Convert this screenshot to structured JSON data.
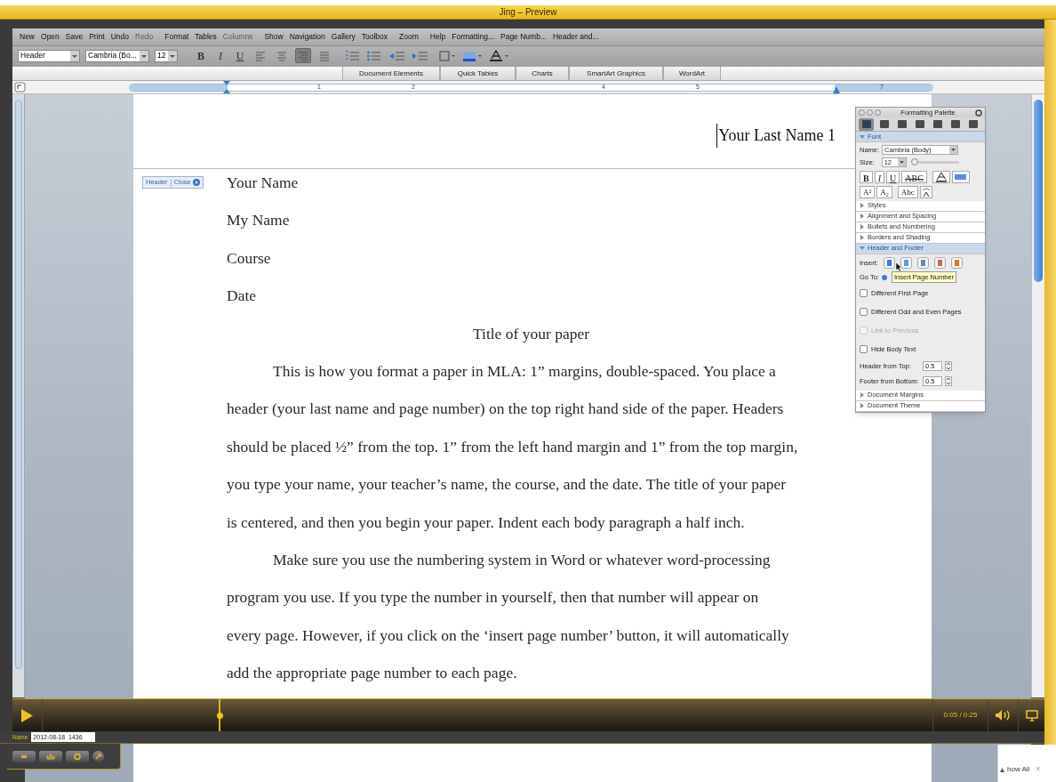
{
  "window": {
    "title": "Jing – Preview"
  },
  "toolbar": [
    {
      "label": "New",
      "disabled": false
    },
    {
      "label": "Open",
      "disabled": false
    },
    {
      "label": "Save",
      "disabled": false
    },
    {
      "label": "Print",
      "disabled": false
    },
    {
      "label": "Undo",
      "disabled": false
    },
    {
      "label": "Redo",
      "disabled": true
    },
    {
      "label": "Format",
      "disabled": false
    },
    {
      "label": "Tables",
      "disabled": false
    },
    {
      "label": "Columns",
      "disabled": true
    },
    {
      "label": "Show",
      "disabled": false
    },
    {
      "label": "Navigation",
      "disabled": false
    },
    {
      "label": "Gallery",
      "disabled": false
    },
    {
      "label": "Toolbox",
      "disabled": false
    },
    {
      "label": "Zoom",
      "disabled": false
    },
    {
      "label": "Help",
      "disabled": false
    },
    {
      "label": "Formatting...",
      "disabled": false
    },
    {
      "label": "Page Numb...",
      "disabled": false
    },
    {
      "label": "Header and...",
      "disabled": false
    }
  ],
  "format_bar": {
    "style": "Header",
    "font": "Cambria (Bo...",
    "size": "12",
    "bold": "B",
    "italic": "I",
    "underline": "U",
    "align_buttons": [
      {
        "selected": false
      },
      {
        "selected": false
      },
      {
        "selected": true
      },
      {
        "selected": false
      }
    ]
  },
  "gallery_tabs": [
    "Document Elements",
    "Quick Tables",
    "Charts",
    "SmartArt Graphics",
    "WordArt"
  ],
  "ruler": {
    "labels": [
      "1",
      "2",
      "4",
      "5",
      "7"
    ]
  },
  "document": {
    "header_text": "Your Last Name 1",
    "header_tab": {
      "label": "Header",
      "close": "Close"
    },
    "heading_lines": [
      "Your Name",
      "My Name",
      "Course",
      "Date"
    ],
    "title": "Title of your paper",
    "paragraphs": [
      {
        "lines": [
          "This is how you format a paper in MLA: 1” margins, double-spaced. You place a",
          "header (your last name and page number) on the top right hand side of the paper. Headers",
          "should be placed ½” from the top. 1” from the left hand margin and 1” from the top margin,",
          "you type your name, your teacher’s name, the course, and the date. The title of your paper",
          "is centered, and then you begin your paper. Indent each body paragraph a half inch."
        ]
      },
      {
        "lines": [
          "Make sure you use the numbering system in Word or whatever word-processing",
          "program you use. If you type the number in yourself, then that number will appear on",
          "every page. However, if you click on the ‘insert page number’ button, it will automatically",
          "add the appropriate page number to each page."
        ]
      }
    ]
  },
  "palette": {
    "title": "Formatting Palette",
    "tabs": [
      {
        "selected": true
      },
      {
        "selected": false
      },
      {
        "selected": false
      },
      {
        "selected": false
      },
      {
        "selected": false
      },
      {
        "selected": false
      },
      {
        "selected": false
      }
    ],
    "font_section": {
      "label": "Font",
      "expanded": true,
      "name_label": "Name:",
      "name_value": "Cambria (Body)",
      "size_label": "Size:",
      "size_value": "12",
      "size_slider": {
        "level": 0
      },
      "style_buttons": [
        "B",
        "I",
        "U",
        "ABC"
      ],
      "script_buttons": [
        "A²",
        "A₂",
        "Abc"
      ]
    },
    "collapsed_sections": [
      "Styles",
      "Alignment and Spacing",
      "Bullets and Numbering",
      "Borders and Shading"
    ],
    "header_footer": {
      "label": "Header and Footer",
      "expanded": true,
      "insert_label": "Insert:",
      "goto_label": "Go To:",
      "tooltip": "Insert Page Number",
      "options": [
        {
          "label": "Different First Page",
          "checked": false,
          "disabled": false
        },
        {
          "label": "Different Odd and Even Pages",
          "checked": false,
          "disabled": false
        },
        {
          "label": "Link to Previous",
          "checked": false,
          "disabled": true
        },
        {
          "label": "Hide Body Text",
          "checked": false,
          "disabled": false
        }
      ],
      "spinners": [
        {
          "label": "Header from Top:",
          "value": "0.5"
        },
        {
          "label": "Footer from Bottom:",
          "value": "0.5"
        }
      ]
    },
    "bottom_sections": [
      "Document Margins",
      "Document Theme"
    ]
  },
  "player": {
    "level": 0.2,
    "time": "0:05 / 0:25"
  },
  "name_field": {
    "label": "Name",
    "value": "2012-08-18_1436"
  },
  "show_all": {
    "label": "how All",
    "close": "×"
  }
}
